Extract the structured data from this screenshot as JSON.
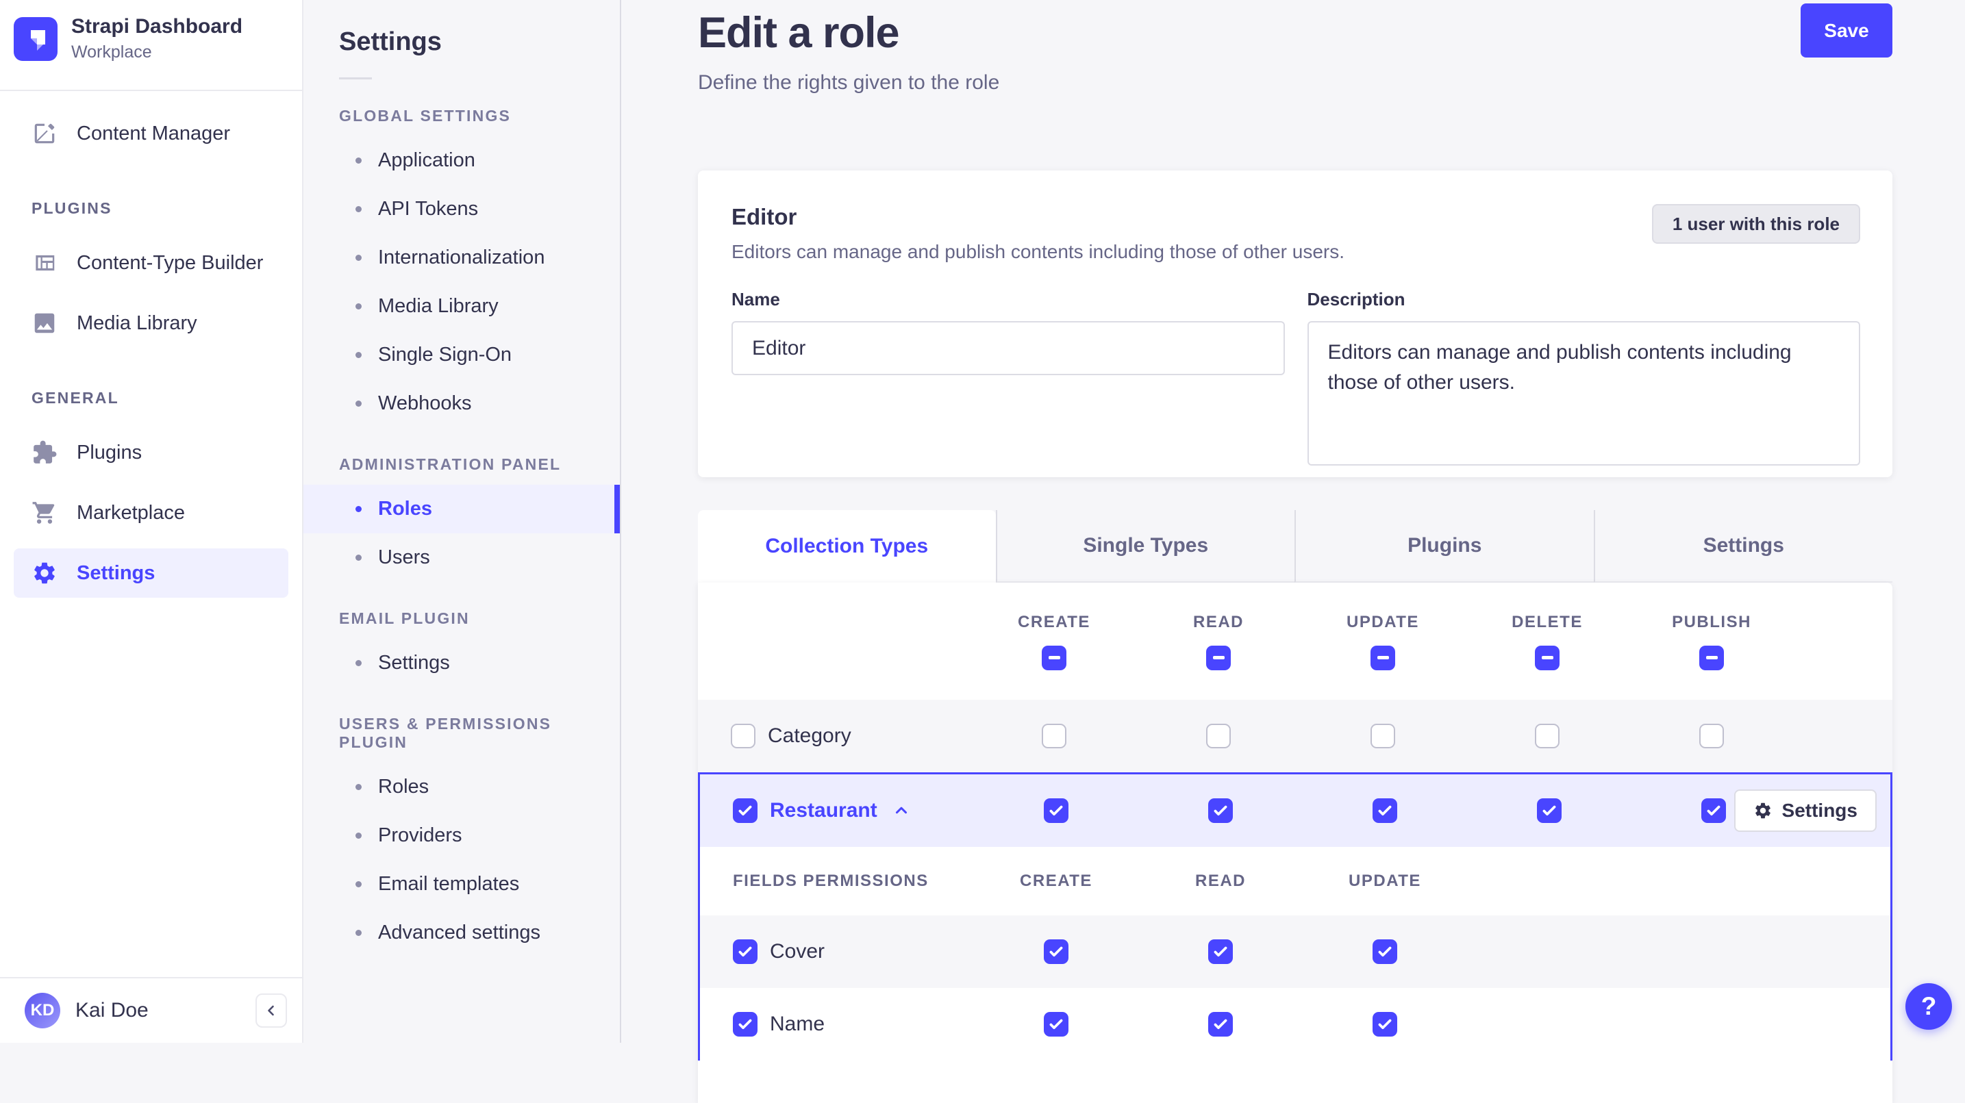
{
  "colors": {
    "accent": "#4945ff",
    "accent_bg": "#f0f0ff",
    "selected_row_bg": "#ededff",
    "page_bg": "#f6f6f9",
    "text_primary": "#32324d",
    "text_secondary": "#666687",
    "border": "#dcdce4",
    "checkbox_border": "#c0c0cf"
  },
  "brand": {
    "title": "Strapi Dashboard",
    "subtitle": "Workplace",
    "logo_icon": "strapi-logo-icon"
  },
  "main_sidebar": {
    "primary_items": [
      {
        "label": "Content Manager",
        "icon": "content-manager-icon",
        "active": false
      }
    ],
    "sections": [
      {
        "label": "PLUGINS",
        "items": [
          {
            "label": "Content-Type Builder",
            "icon": "content-type-builder-icon",
            "active": false
          },
          {
            "label": "Media Library",
            "icon": "media-library-icon",
            "active": false
          }
        ]
      },
      {
        "label": "GENERAL",
        "items": [
          {
            "label": "Plugins",
            "icon": "plugins-icon",
            "active": false
          },
          {
            "label": "Marketplace",
            "icon": "marketplace-icon",
            "active": false
          },
          {
            "label": "Settings",
            "icon": "settings-icon",
            "active": true
          }
        ]
      }
    ],
    "user": {
      "initials": "KD",
      "name": "Kai Doe"
    },
    "collapse_icon": "chevron-left-icon"
  },
  "settings_sidebar": {
    "title": "Settings",
    "groups": [
      {
        "label": "GLOBAL SETTINGS",
        "items": [
          {
            "label": "Application",
            "active": false
          },
          {
            "label": "API Tokens",
            "active": false
          },
          {
            "label": "Internationalization",
            "active": false
          },
          {
            "label": "Media Library",
            "active": false
          },
          {
            "label": "Single Sign-On",
            "active": false
          },
          {
            "label": "Webhooks",
            "active": false
          }
        ]
      },
      {
        "label": "ADMINISTRATION PANEL",
        "items": [
          {
            "label": "Roles",
            "active": true
          },
          {
            "label": "Users",
            "active": false
          }
        ]
      },
      {
        "label": "EMAIL PLUGIN",
        "items": [
          {
            "label": "Settings",
            "active": false
          }
        ]
      },
      {
        "label": "USERS & PERMISSIONS PLUGIN",
        "items": [
          {
            "label": "Roles",
            "active": false
          },
          {
            "label": "Providers",
            "active": false
          },
          {
            "label": "Email templates",
            "active": false
          },
          {
            "label": "Advanced settings",
            "active": false
          }
        ]
      }
    ]
  },
  "page": {
    "title": "Edit a role",
    "subtitle": "Define the rights given to the role",
    "save_label": "Save"
  },
  "role_card": {
    "title": "Editor",
    "description": "Editors can manage and publish contents including those of other users.",
    "users_badge": "1 user with this role",
    "name_label": "Name",
    "name_value": "Editor",
    "description_label": "Description",
    "description_value": "Editors can manage and publish contents including those of other users."
  },
  "tabs": [
    {
      "label": "Collection Types",
      "active": true
    },
    {
      "label": "Single Types",
      "active": false
    },
    {
      "label": "Plugins",
      "active": false
    },
    {
      "label": "Settings",
      "active": false
    }
  ],
  "permissions": {
    "columns": [
      "CREATE",
      "READ",
      "UPDATE",
      "DELETE",
      "PUBLISH"
    ],
    "header_state": "indeterminate",
    "rows": [
      {
        "label": "Category",
        "checked": false,
        "expanded": false,
        "cells": [
          "unchecked",
          "unchecked",
          "unchecked",
          "unchecked",
          "unchecked"
        ]
      },
      {
        "label": "Restaurant",
        "checked": true,
        "expanded": true,
        "cells": [
          "checked",
          "checked",
          "checked",
          "checked",
          "checked"
        ],
        "settings_label": "Settings",
        "chevron": "chevron-up-icon"
      }
    ],
    "fields_section": {
      "title": "FIELDS PERMISSIONS",
      "columns": [
        "CREATE",
        "READ",
        "UPDATE"
      ],
      "rows": [
        {
          "label": "Cover",
          "checked": true,
          "cells": [
            "checked",
            "checked",
            "checked"
          ]
        },
        {
          "label": "Name",
          "checked": true,
          "cells": [
            "checked",
            "checked",
            "checked"
          ]
        }
      ]
    }
  },
  "help_button": {
    "label": "?"
  }
}
